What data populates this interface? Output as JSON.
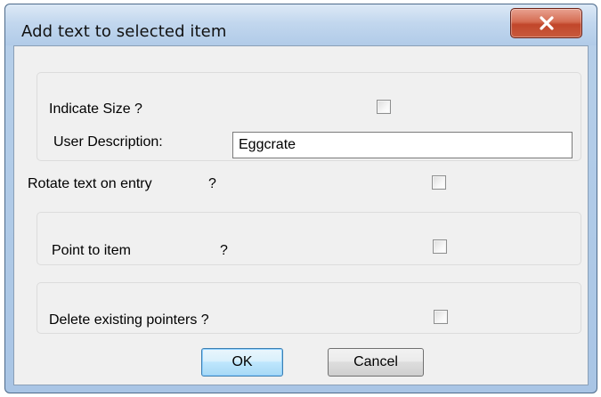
{
  "dialog": {
    "title": "Add text to selected item",
    "close_glyph": "X"
  },
  "fields": {
    "indicate_size_label": "Indicate Size ?",
    "user_description_label": "User Description:",
    "user_description_value": "Eggcrate",
    "rotate_text_label": "Rotate text on entry",
    "rotate_text_q": "?",
    "point_to_item_label": "Point to item",
    "point_to_item_q": "?",
    "delete_pointers_label": "Delete existing pointers ?"
  },
  "checkboxes": {
    "indicate_size": false,
    "rotate_text": false,
    "point_to_item": false,
    "delete_pointers": false
  },
  "buttons": {
    "ok_label": "OK",
    "cancel_label": "Cancel"
  },
  "colors": {
    "close_button": "#c8472c",
    "frame": "#b6cfe9",
    "client_bg": "#f0f0f0"
  }
}
